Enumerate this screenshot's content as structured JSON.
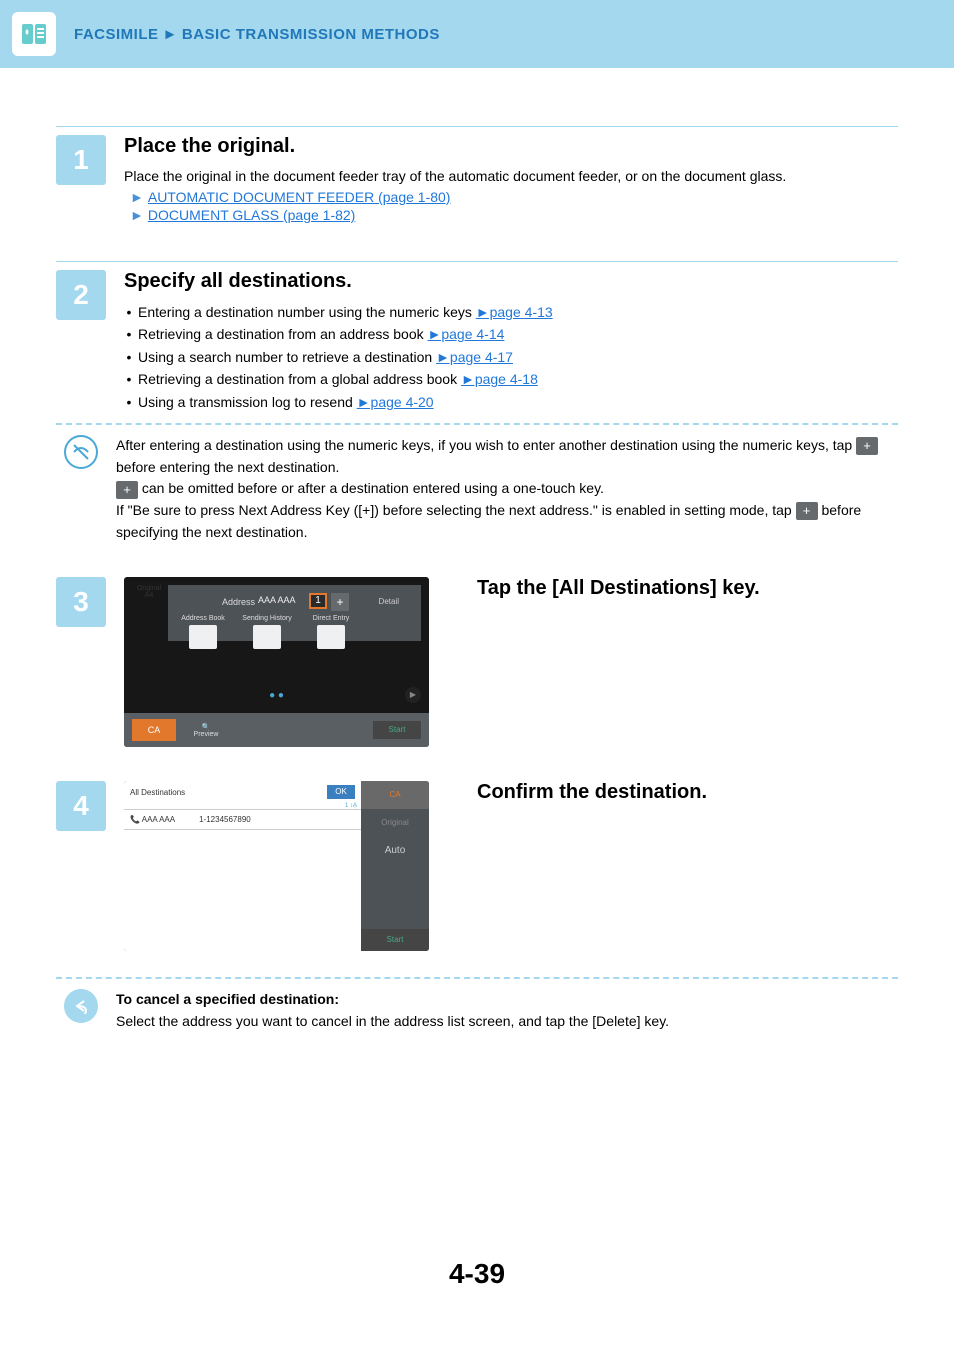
{
  "breadcrumb": {
    "a": "FACSIMILE",
    "sep": "►",
    "b": "BASIC TRANSMISSION METHODS"
  },
  "step1": {
    "num": "1",
    "title": "Place the original.",
    "body": "Place the original in the document feeder tray of the automatic document feeder, or on the document glass.",
    "arrow": "►",
    "link1": "AUTOMATIC DOCUMENT FEEDER (page 1-80)",
    "link2": "DOCUMENT GLASS (page 1-82)"
  },
  "step2": {
    "num": "2",
    "title": "Specify all destinations.",
    "items": [
      {
        "text": "Entering a destination number using the numeric keys ",
        "link": "►page 4-13"
      },
      {
        "text": "Retrieving a destination from an address book ",
        "link": "►page 4-14"
      },
      {
        "text": "Using a search number to retrieve a destination ",
        "link": "►page 4-17"
      },
      {
        "text": "Retrieving a destination from a global address book ",
        "link": "►page 4-18"
      },
      {
        "text": "Using a transmission log to resend ",
        "link": "►page 4-20"
      }
    ]
  },
  "note1": {
    "line1a": "After entering a destination using the numeric keys, if you wish to enter another destination using the numeric keys, tap ",
    "plus": "+",
    "line1b": " before entering the next destination.",
    "line2b": " can be omitted before or after a destination entered using a one-touch key.",
    "line3a": "If \"Be sure to press Next Address Key ([+]) before selecting the next address.\" is enabled in setting mode, tap ",
    "line3b": " before specifying the next destination."
  },
  "step3": {
    "num": "3",
    "title": "Tap the [All Destinations] key.",
    "screen": {
      "original_label": "Original",
      "original_size": "A4",
      "address_label": "Address",
      "address_value": "AAA AAA",
      "count": "1",
      "plus": "+",
      "detail": "Detail",
      "card1": "Address Book",
      "card2": "Sending History",
      "card3": "Direct Entry",
      "ca": "CA",
      "preview": "Preview",
      "start": "Start"
    }
  },
  "step4": {
    "num": "4",
    "title": "Confirm the destination.",
    "screen": {
      "header": "All Destinations",
      "ok": "OK",
      "subinfo": "1    ↕A͎",
      "row_name": "AAA AAA",
      "row_num": "1-1234567890",
      "ca": "CA",
      "dim1": "Original",
      "auto": "Auto",
      "start": "Start"
    }
  },
  "note2": {
    "title": "To cancel a specified destination:",
    "body": "Select the address you want to cancel in the address list screen, and tap the [Delete] key."
  },
  "page": "4-39"
}
